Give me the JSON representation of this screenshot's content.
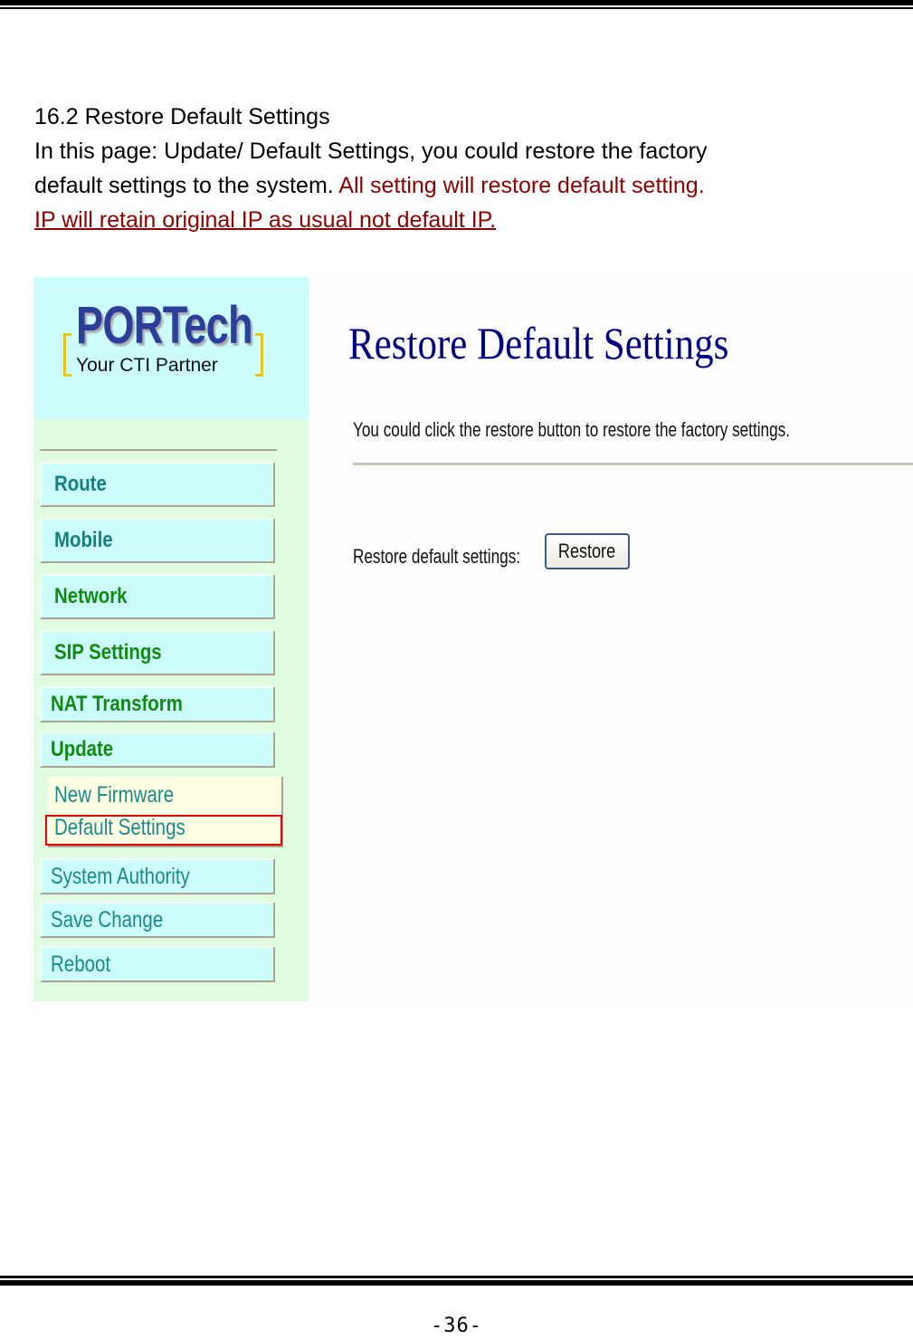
{
  "document": {
    "heading": "16.2 Restore Default Settings",
    "paragraph_line1": "In this page: Update/ Default Settings, you could restore the factory",
    "paragraph_line2": "default settings to the system. ",
    "paragraph_red": "All setting will restore default setting.",
    "paragraph_red_underlined": "IP will retain original IP as usual not default IP.",
    "page_number": "-36-",
    "colors": {
      "emphasis": "#8b0000",
      "highlight_box": "#e00000"
    }
  },
  "screenshot": {
    "logo": {
      "brand": "PORTech",
      "tagline": "Your CTI Partner"
    },
    "sidebar": {
      "items": [
        {
          "label": "Route"
        },
        {
          "label": "Mobile"
        },
        {
          "label": "Network"
        },
        {
          "label": "SIP Settings"
        },
        {
          "label": "NAT Transform"
        },
        {
          "label": "Update"
        },
        {
          "label": "System Authority"
        },
        {
          "label": "Save Change"
        },
        {
          "label": "Reboot"
        }
      ],
      "update_submenu": [
        {
          "label": "New Firmware"
        },
        {
          "label": "Default Settings",
          "highlighted": true
        }
      ]
    },
    "main": {
      "title": "Restore Default Settings",
      "description": "You could click the restore button to restore the factory settings.",
      "restore_label": "Restore default settings:",
      "restore_button": "Restore"
    }
  }
}
